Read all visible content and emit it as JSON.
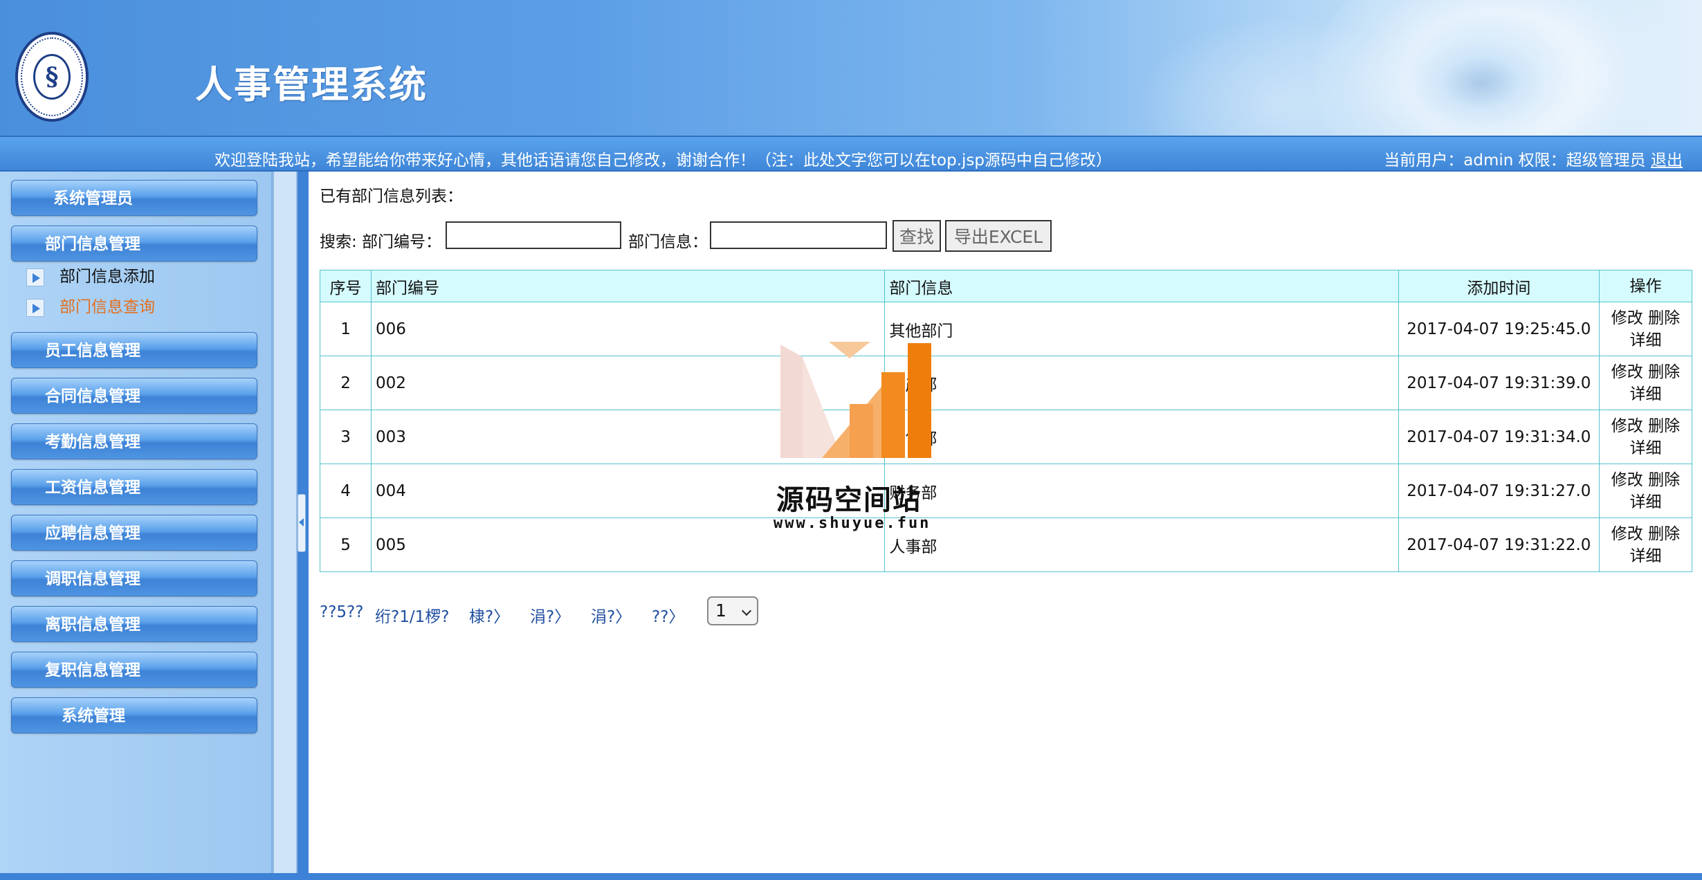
{
  "header": {
    "title": "人事管理系统"
  },
  "statusbar": {
    "welcome": "欢迎登陆我站，希望能给你带来好心情，其他话语请您自己修改，谢谢合作！（注：此处文字您可以在top.jsp源码中自己修改）",
    "user_label": "当前用户：admin 权限：超级管理员",
    "logout": "退出"
  },
  "sidebar": {
    "menus": [
      {
        "label": "系统管理员"
      },
      {
        "label": "部门信息管理"
      },
      {
        "label": "员工信息管理"
      },
      {
        "label": "合同信息管理"
      },
      {
        "label": "考勤信息管理"
      },
      {
        "label": "工资信息管理"
      },
      {
        "label": "应聘信息管理"
      },
      {
        "label": "调职信息管理"
      },
      {
        "label": "离职信息管理"
      },
      {
        "label": "复职信息管理"
      },
      {
        "label": "系统管理"
      }
    ],
    "submenu": [
      {
        "label": "部门信息添加"
      },
      {
        "label": "部门信息查询"
      }
    ]
  },
  "main": {
    "list_title": "已有部门信息列表：",
    "search": {
      "label_prefix": "搜索: 部门编号：",
      "label_info": "部门信息：",
      "dept_no_value": "",
      "dept_info_value": "",
      "find_button": "查找",
      "export_button": "导出EXCEL"
    },
    "table": {
      "headers": [
        "序号",
        "部门编号",
        "部门信息",
        "添加时间",
        "操作"
      ],
      "rows": [
        {
          "idx": "1",
          "no": "006",
          "info": "其他部门",
          "time": "2017-04-07 19:25:45.0"
        },
        {
          "idx": "2",
          "no": "002",
          "info": "生产部",
          "time": "2017-04-07 19:31:39.0"
        },
        {
          "idx": "3",
          "no": "003",
          "info": "销售部",
          "time": "2017-04-07 19:31:34.0"
        },
        {
          "idx": "4",
          "no": "004",
          "info": "财务部",
          "time": "2017-04-07 19:31:27.0"
        },
        {
          "idx": "5",
          "no": "005",
          "info": "人事部",
          "time": "2017-04-07 19:31:22.0"
        }
      ],
      "op_edit": "修改",
      "op_delete": "删除",
      "op_detail": "详细"
    },
    "pager": {
      "total": "??5??",
      "page_info": "绗?1/1椤?",
      "first": "棣?〉",
      "prev": "涓?〉",
      "next": "涓?〉",
      "last": "??〉",
      "selected": "1"
    }
  },
  "watermark": {
    "name": "源码空间站",
    "url": "www.shuyue.fun"
  }
}
